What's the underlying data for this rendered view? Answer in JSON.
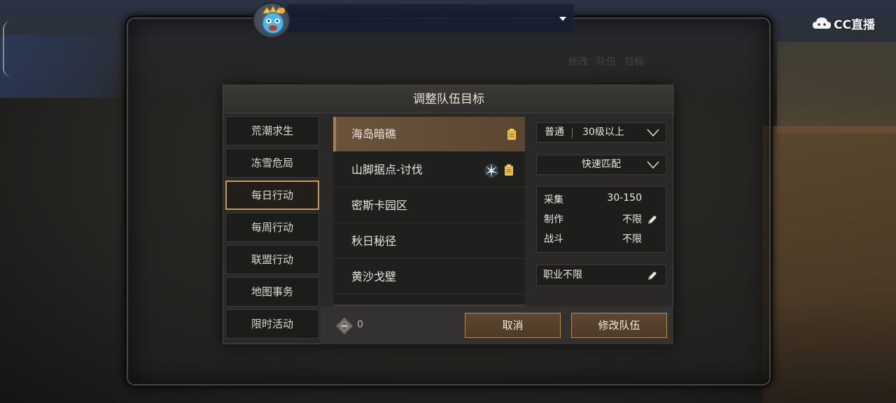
{
  "header": {
    "logo_text": "CC直播"
  },
  "background_texts": [
    "修改",
    "队伍",
    "目标"
  ],
  "dialog": {
    "title": "调整队伍目标",
    "categories": [
      {
        "label": "荒潮求生",
        "active": false
      },
      {
        "label": "冻雪危局",
        "active": false
      },
      {
        "label": "每日行动",
        "active": true
      },
      {
        "label": "每周行动",
        "active": false
      },
      {
        "label": "联盟行动",
        "active": false
      },
      {
        "label": "地图事务",
        "active": false
      },
      {
        "label": "限时活动",
        "active": false
      }
    ],
    "maps": [
      {
        "label": "海岛暗礁",
        "selected": true,
        "icons": [
          "clipboard-icon"
        ]
      },
      {
        "label": "山脚据点-讨伐",
        "selected": false,
        "icons": [
          "spark-icon",
          "clipboard-icon"
        ]
      },
      {
        "label": "密斯卡园区",
        "selected": false,
        "icons": []
      },
      {
        "label": "秋日秘径",
        "selected": false,
        "icons": []
      },
      {
        "label": "黄沙戈壁",
        "selected": false,
        "icons": []
      }
    ],
    "difficulty": {
      "mode": "普通",
      "level": "30级以上"
    },
    "match_mode": "快速匹配",
    "requirements": [
      {
        "key": "采集",
        "value": "30-150"
      },
      {
        "key": "制作",
        "value": "不限"
      },
      {
        "key": "战斗",
        "value": "不限"
      }
    ],
    "job": "职业不限",
    "currency_count": "0",
    "cancel_label": "取消",
    "confirm_label": "修改队伍"
  },
  "colors": {
    "accent_gold": "#c49a5c",
    "selected_row": "#6b533b",
    "button_fill": "#5e4630",
    "clipboard": "#e8c04a"
  }
}
